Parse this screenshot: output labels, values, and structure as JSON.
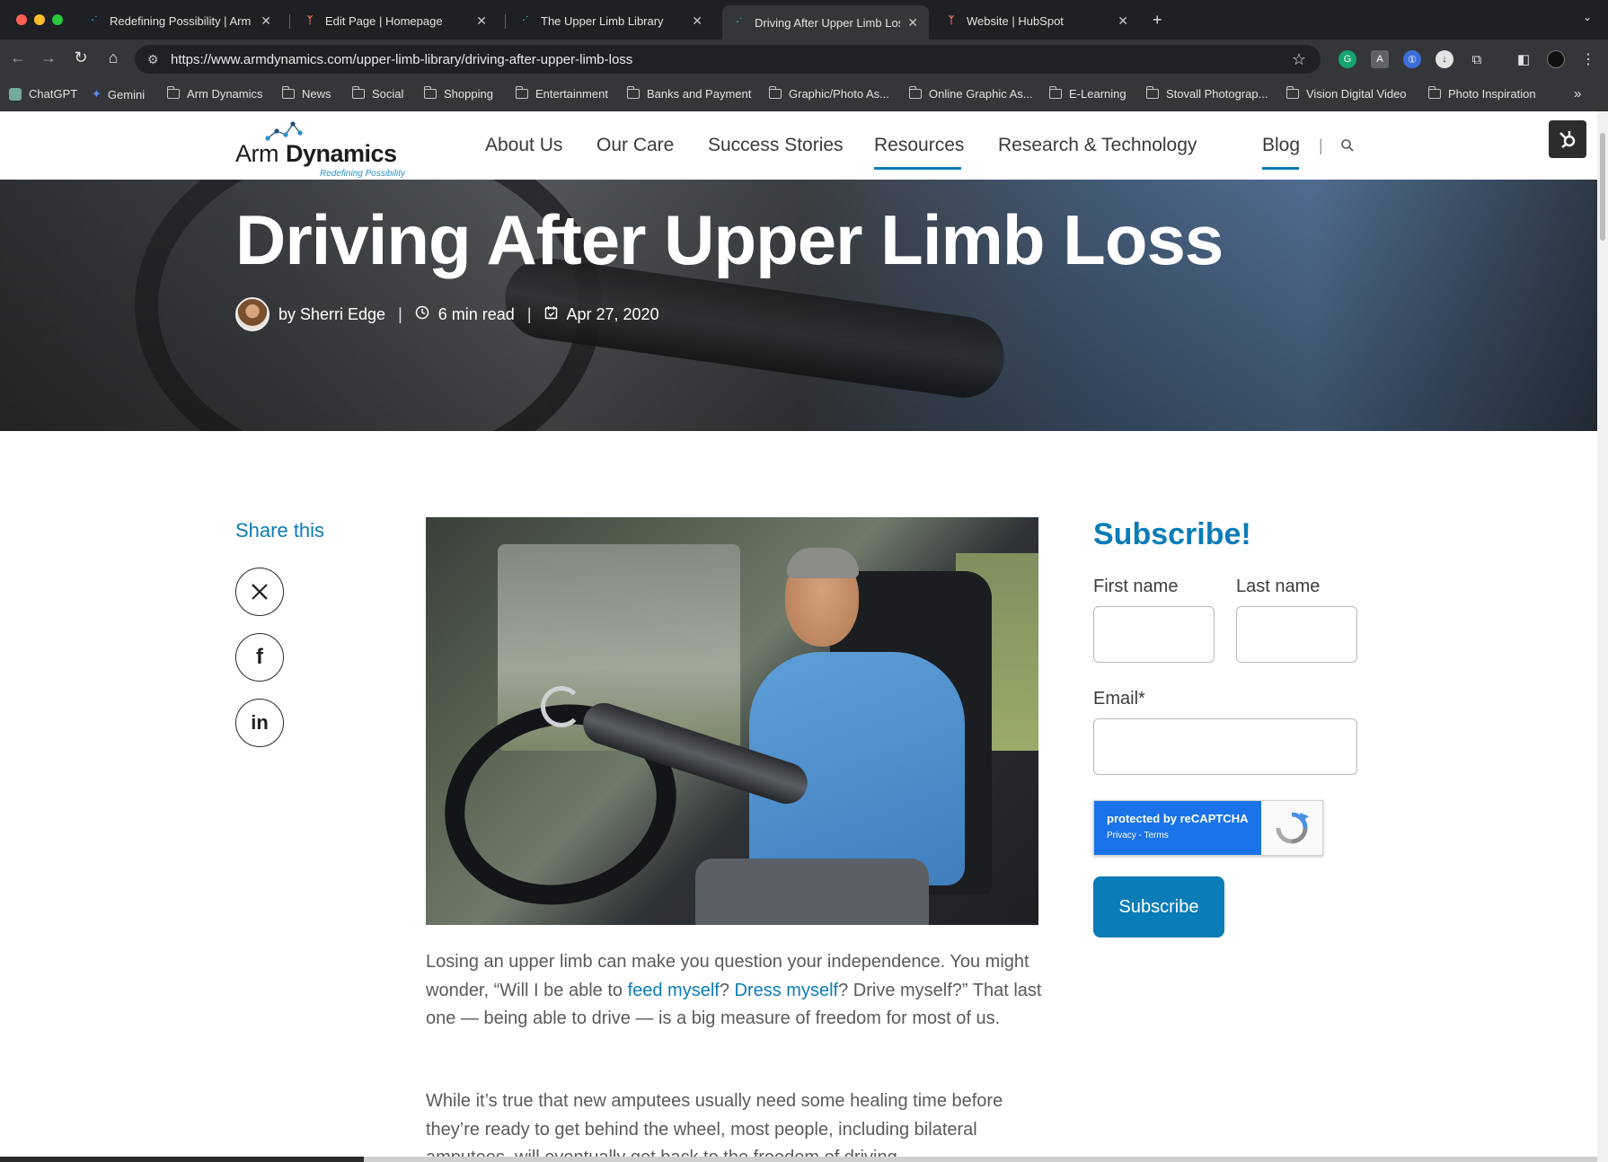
{
  "browser": {
    "tabs": [
      {
        "title": "Redefining Possibility | Arm D",
        "favicon": "arm-dynamics-icon"
      },
      {
        "title": "Edit Page | Homepage",
        "favicon": "hubspot-icon"
      },
      {
        "title": "The Upper Limb Library",
        "favicon": "arm-dynamics-icon"
      },
      {
        "title": "Driving After Upper Limb Los",
        "favicon": "arm-dynamics-icon",
        "active": true
      },
      {
        "title": "Website | HubSpot",
        "favicon": "hubspot-icon"
      }
    ],
    "url": "https://www.armdynamics.com/upper-limb-library/driving-after-upper-limb-loss",
    "bookmarks": [
      {
        "label": "ChatGPT",
        "icon": "chatgpt-icon"
      },
      {
        "label": "Gemini",
        "icon": "gemini-icon"
      },
      {
        "label": "Arm Dynamics",
        "icon": "folder-icon"
      },
      {
        "label": "News",
        "icon": "folder-icon"
      },
      {
        "label": "Social",
        "icon": "folder-icon"
      },
      {
        "label": "Shopping",
        "icon": "folder-icon"
      },
      {
        "label": "Entertainment",
        "icon": "folder-icon"
      },
      {
        "label": "Banks and Payment",
        "icon": "folder-icon"
      },
      {
        "label": "Graphic/Photo As...",
        "icon": "folder-icon"
      },
      {
        "label": "Online Graphic As...",
        "icon": "folder-icon"
      },
      {
        "label": "E-Learning",
        "icon": "folder-icon"
      },
      {
        "label": "Stovall Photograp...",
        "icon": "folder-icon"
      },
      {
        "label": "Vision Digital Video",
        "icon": "folder-icon"
      },
      {
        "label": "Photo Inspiration",
        "icon": "folder-icon"
      }
    ]
  },
  "site": {
    "logo": {
      "word1": "Arm",
      "word2": "Dynamics",
      "tagline": "Redefining Possibility"
    },
    "nav": [
      {
        "label": "About Us"
      },
      {
        "label": "Our Care"
      },
      {
        "label": "Success Stories"
      },
      {
        "label": "Resources",
        "active": true
      },
      {
        "label": "Research & Technology"
      },
      {
        "label": "Blog",
        "active": true
      }
    ],
    "nav_separator": "|"
  },
  "hero": {
    "title": "Driving After Upper Limb Loss",
    "author": "by Sherri Edge",
    "read_time": "6 min read",
    "date": "Apr 27, 2020",
    "separator": "|"
  },
  "share": {
    "title": "Share this",
    "buttons": [
      {
        "network": "X",
        "icon": "x-icon"
      },
      {
        "network": "Facebook",
        "icon": "facebook-icon"
      },
      {
        "network": "LinkedIn",
        "icon": "linkedin-icon"
      }
    ]
  },
  "article": {
    "p1_a": "Losing an upper limb can make you question your independence. You might wonder, “Will I be able to ",
    "p1_link1": "feed myself",
    "p1_b": "? ",
    "p1_link2": "Dress myself",
    "p1_c": "? Drive myself?” That last one — being able to drive — is a big measure of freedom for most of us.",
    "p2": "While it’s true that new amputees usually need some healing time before they’re ready to get behind the wheel, most people, including bilateral amputees, will eventually get back to the freedom of driving."
  },
  "subscribe": {
    "title": "Subscribe!",
    "first_name_label": "First name",
    "last_name_label": "Last name",
    "email_label": "Email*",
    "first_name_value": "",
    "last_name_value": "",
    "email_value": "",
    "recaptcha_text": "protected by reCAPTCHA",
    "recaptcha_links": "Privacy - Terms",
    "button": "Subscribe"
  },
  "colors": {
    "accent": "#0a7cb8",
    "recaptcha_blue": "#1a73e8",
    "body_text": "#5a5a5a"
  }
}
